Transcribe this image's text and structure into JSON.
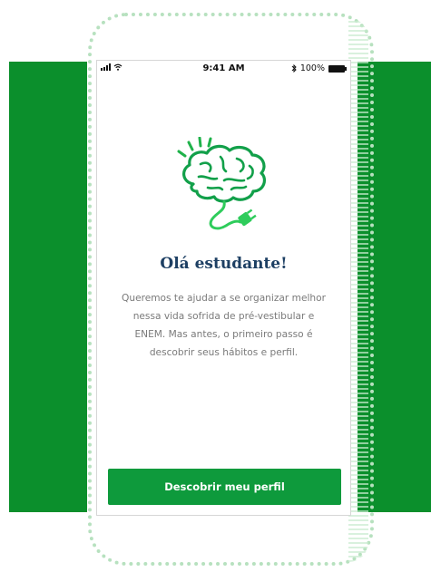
{
  "status_bar": {
    "time": "9:41 AM",
    "battery": "100%"
  },
  "icons": {
    "illustration": "brain-plug-icon",
    "signal": "signal-icon",
    "wifi": "wifi-icon",
    "bluetooth": "bluetooth-icon",
    "battery": "battery-icon"
  },
  "onboarding": {
    "title": "Olá estudante!",
    "line1": "Queremos te ajudar a se organizar melhor",
    "line2": "nessa vida sofrida de pré-vestibular e",
    "line3": "ENEM. Mas antes, o primeiro passo é",
    "line4": "descobrir seus hábitos e perfil.",
    "button_label": "Descobrir meu perfil"
  },
  "colors": {
    "brand_green": "#0e9a3c",
    "title_navy": "#1d3f63",
    "body_gray": "#7a7a7a"
  }
}
